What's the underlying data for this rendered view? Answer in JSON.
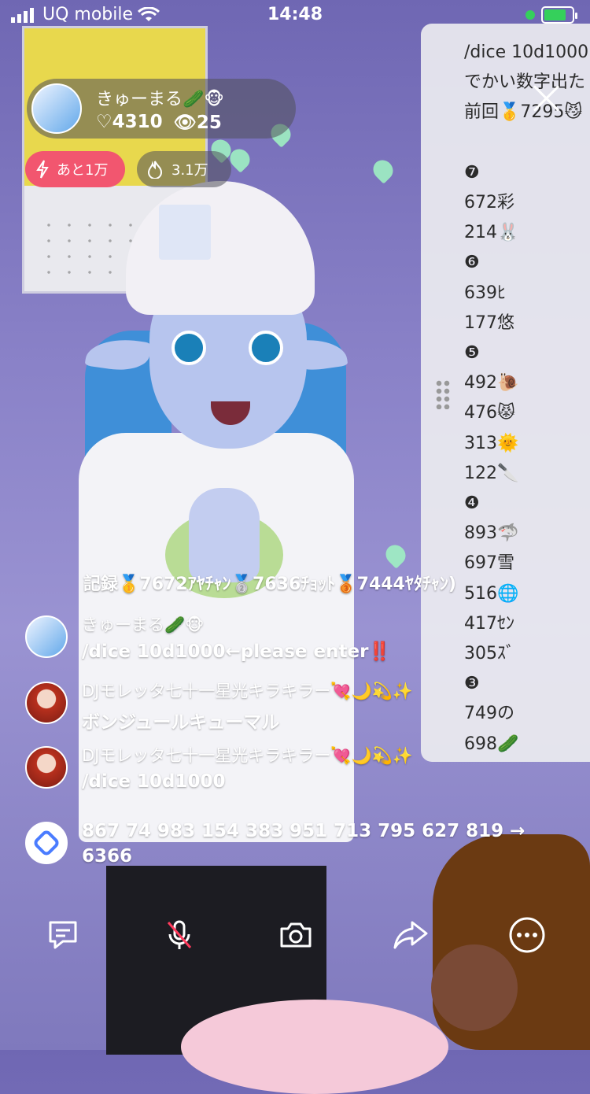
{
  "status": {
    "carrier": "UQ mobile",
    "time": "14:48",
    "battery_level": 0.7,
    "battery_color": "#35d05b"
  },
  "profile": {
    "name": "きゅーまる🥒🐵",
    "likes": "♡4310",
    "viewers": "👁25"
  },
  "badges": {
    "goal_label": "あと1万",
    "points_label": "3.1万"
  },
  "panel": {
    "lines": [
      "/dice 10d1000",
      "でかい数字出た",
      "前回🥇7295😼",
      "",
      "❼",
      "672彩",
      "214🐰",
      "❻",
      "639ﾋ",
      "177悠",
      "❺",
      "492🐌",
      "476😾",
      "313🌞",
      "122🔪",
      "❹",
      "893🦈",
      "697雪",
      "516🌐",
      "417ｾﾝ",
      "305ｽﾞ",
      "❸",
      "749の",
      "698🥒"
    ]
  },
  "chat": {
    "record": "記録🥇7672ｱﾔﾁｬﾝ🥈7636ﾁｮｯﾄ🥉7444ﾔﾀﾁｬﾝ)",
    "messages": [
      {
        "name": "きゅーまる🥒🐵",
        "text": "/dice 10d1000←please enter‼️"
      },
      {
        "name": "DJモレッタ七十一星光キラキラー💘🌙💫✨",
        "text": "ボンジュールキューマル"
      },
      {
        "name": "DJモレッタ七十一星光キラキラー💘🌙💫✨",
        "text": "/dice 10d1000"
      }
    ],
    "bot_text": "867 74 983 154 383 951 713 795 627 819 → 6366"
  },
  "toolbar": {
    "icons": [
      "comment-icon",
      "mic-muted-icon",
      "camera-icon",
      "share-icon",
      "more-icon"
    ]
  },
  "colors": {
    "goal_pill": "#f2566f",
    "mute_slash": "#ff3b5c",
    "panel_bg": "#ebebf0"
  }
}
